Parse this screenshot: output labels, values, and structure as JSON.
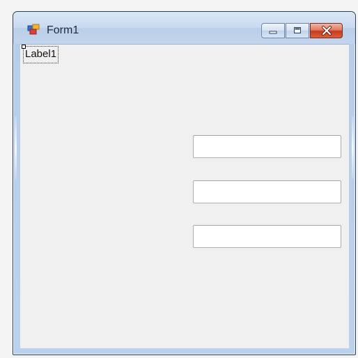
{
  "window": {
    "title": "Form1",
    "icon": "winforms-form-icon",
    "caption_buttons": {
      "minimize": "minimize-icon",
      "maximize": "maximize-icon",
      "close": "close-icon"
    }
  },
  "form": {
    "label1": "Label1",
    "textboxes": [
      {
        "value": ""
      },
      {
        "value": ""
      },
      {
        "value": ""
      }
    ]
  },
  "colors": {
    "frame_blue": "#c3d6ee",
    "client_bg": "#f0f0f0",
    "close_red": "#c8381c"
  }
}
